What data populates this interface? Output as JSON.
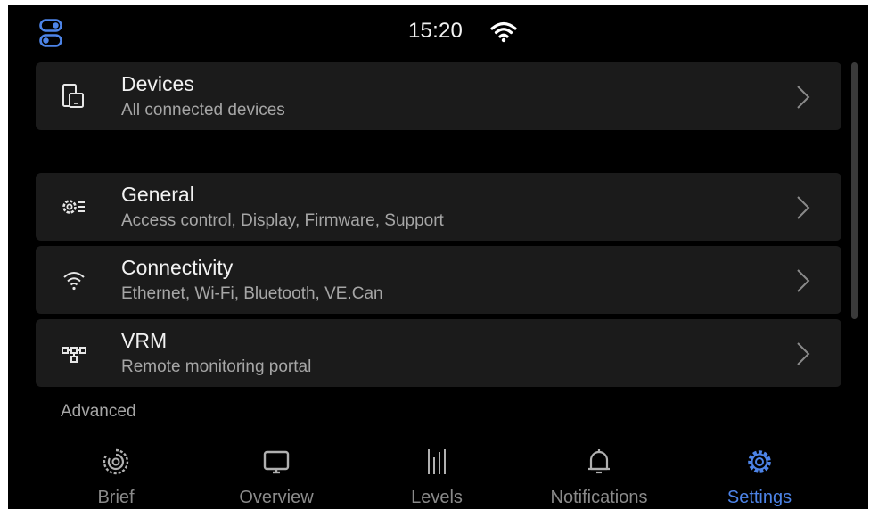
{
  "status_bar": {
    "time": "15:20",
    "toggle_icon": "toggle-switch-icon",
    "wifi_icon": "wifi-icon"
  },
  "rows": [
    {
      "title": "Devices",
      "subtitle": "All connected devices",
      "icon": "devices-icon"
    },
    {
      "title": "General",
      "subtitle": "Access control, Display, Firmware, Support",
      "icon": "gear-list-icon"
    },
    {
      "title": "Connectivity",
      "subtitle": "Ethernet, Wi-Fi, Bluetooth, VE.Can",
      "icon": "wifi-icon"
    },
    {
      "title": "VRM",
      "subtitle": "Remote monitoring portal",
      "icon": "network-icon"
    }
  ],
  "section": {
    "advanced_label": "Advanced"
  },
  "nav": {
    "items": [
      {
        "label": "Brief",
        "icon": "brief-icon",
        "active": false
      },
      {
        "label": "Overview",
        "icon": "overview-icon",
        "active": false
      },
      {
        "label": "Levels",
        "icon": "levels-icon",
        "active": false
      },
      {
        "label": "Notifications",
        "icon": "bell-icon",
        "active": false
      },
      {
        "label": "Settings",
        "icon": "gear-icon",
        "active": true
      }
    ]
  },
  "colors": {
    "background": "#000000",
    "row_background": "#1b1b1b",
    "primary_text": "#f2f2f2",
    "secondary_text": "#a6a6a6",
    "accent": "#4d84e8",
    "inactive_nav": "#8a8a8a"
  }
}
